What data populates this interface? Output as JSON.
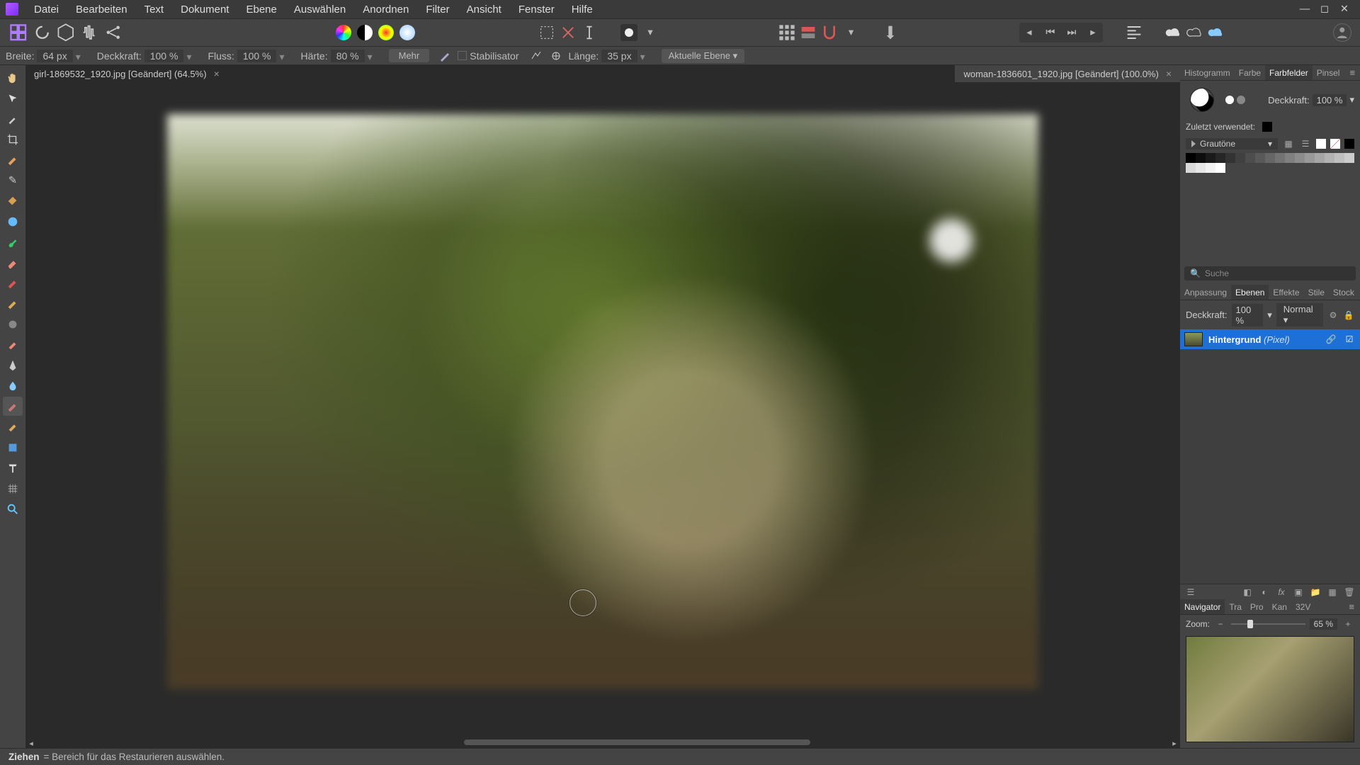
{
  "menu": [
    "Datei",
    "Bearbeiten",
    "Text",
    "Dokument",
    "Ebene",
    "Auswählen",
    "Anordnen",
    "Filter",
    "Ansicht",
    "Fenster",
    "Hilfe"
  ],
  "context": {
    "width_label": "Breite:",
    "width_value": "64 px",
    "opacity_label": "Deckkraft:",
    "opacity_value": "100 %",
    "flow_label": "Fluss:",
    "flow_value": "100 %",
    "hardness_label": "Härte:",
    "hardness_value": "80 %",
    "more": "Mehr",
    "stabilizer": "Stabilisator",
    "length_label": "Länge:",
    "length_value": "35 px",
    "target": "Aktuelle Ebene"
  },
  "tabs": [
    {
      "label": "girl-1869532_1920.jpg [Geändert] (64.5%)",
      "active": true
    },
    {
      "label": "woman-1836601_1920.jpg [Geändert] (100.0%)",
      "active": false
    }
  ],
  "rightTop": {
    "tabs": [
      "Histogramm",
      "Farbe",
      "Farbfelder",
      "Pinsel"
    ],
    "active": 2,
    "opacity_label": "Deckkraft:",
    "opacity_value": "100 %",
    "recent_label": "Zuletzt verwendet:",
    "palette": "Grautöne"
  },
  "search_placeholder": "Suche",
  "panels2": {
    "tabs": [
      "Anpassung",
      "Ebenen",
      "Effekte",
      "Stile",
      "Stock"
    ],
    "active": 1,
    "opacity_label": "Deckkraft:",
    "opacity_value": "100 %",
    "blend": "Normal"
  },
  "layer": {
    "name": "Hintergrund",
    "type": "(Pixel)"
  },
  "navTabs": {
    "tabs": [
      "Navigator",
      "Tra",
      "Pro",
      "Kan",
      "32V"
    ],
    "active": 0
  },
  "nav": {
    "zoom_label": "Zoom:",
    "zoom_value": "65 %"
  },
  "status": {
    "action": "Ziehen",
    "hint": "= Bereich für das Restaurieren auswählen."
  },
  "grays": [
    "#000",
    "#0d0d0d",
    "#1a1a1a",
    "#262626",
    "#333",
    "#404040",
    "#4d4d4d",
    "#595959",
    "#666",
    "#737373",
    "#808080",
    "#8c8c8c",
    "#999",
    "#a6a6a6",
    "#b3b3b3",
    "#bfbfbf",
    "#ccc",
    "#d9d9d9",
    "#e6e6e6",
    "#f2f2f2",
    "#fff"
  ]
}
